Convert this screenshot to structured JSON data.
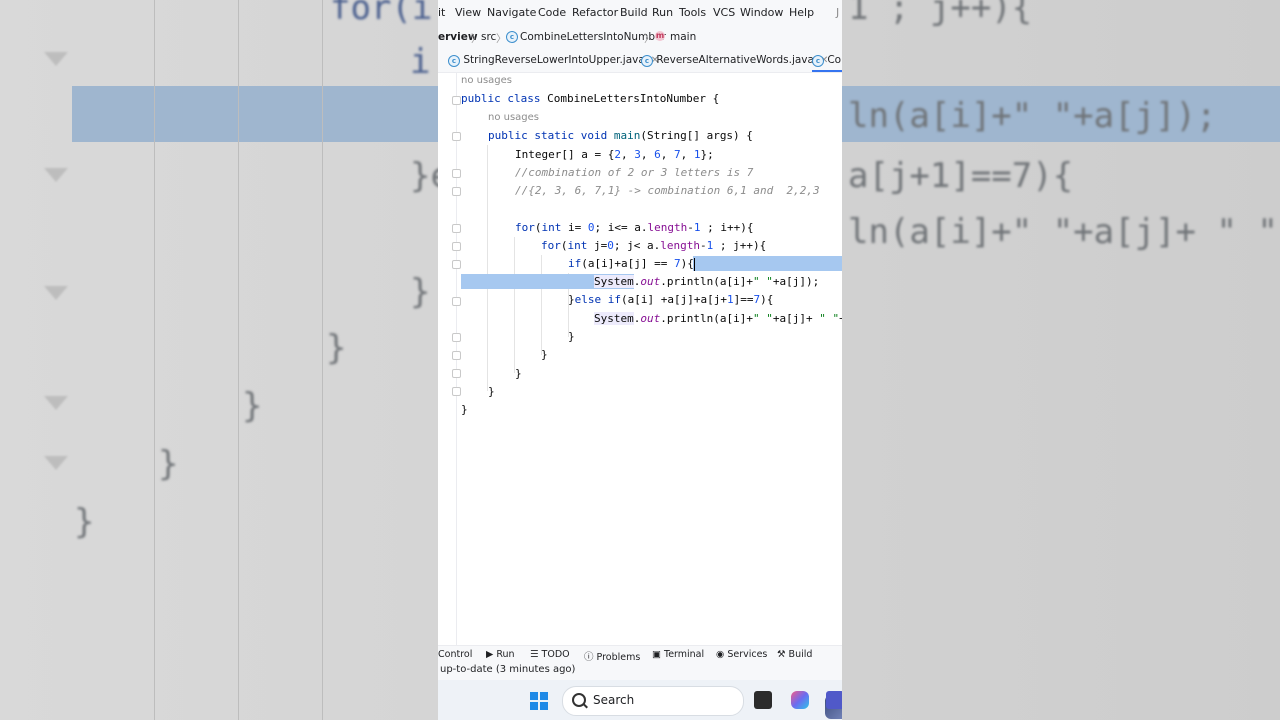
{
  "background_code": {
    "l1": "for(i",
    "l1b": "1 ; j++){",
    "l2": "i",
    "r1": "ln(a[i]+\" \"+a[j]);",
    "r2": "a[j+1]==7){",
    "r3": "ln(a[i]+\" \"+a[j]+ \" \"",
    "b1": "}e",
    "b2": "}",
    "b3": "}",
    "b4": "}",
    "b5": "}",
    "b6": "}"
  },
  "menu": [
    "it",
    "View",
    "Navigate",
    "Code",
    "Refactor",
    "Build",
    "Run",
    "Tools",
    "VCS",
    "Window",
    "Help",
    "J"
  ],
  "breadcrumb": {
    "project": "erview",
    "src": "src",
    "class": "CombineLettersIntoNumber",
    "method": "main",
    "class_icon": "c",
    "method_icon": "m"
  },
  "tabs": [
    {
      "label": "StringReverseLowerIntoUpper.java"
    },
    {
      "label": "ReverseAlternativeWords.java"
    },
    {
      "label": "Co"
    }
  ],
  "editor": {
    "hint1": "no usages",
    "hint2": "no usages",
    "class_decl": {
      "kw": "public class",
      "name": "CombineLettersIntoNumber {"
    },
    "main_decl": {
      "kw": "public static void",
      "name": "main",
      "rest": "(String[] args) {"
    },
    "line_array": {
      "pre": "Integer[] a = {",
      "n1": "2",
      "n2": "3",
      "n3": "6",
      "n4": "7",
      "n5": "1",
      "post": "};"
    },
    "comment1": "//combination of 2 or 3 letters is 7",
    "comment2": "//{2, 3, 6, 7,1} -> combination 6,1 and  2,2,3",
    "for1": {
      "kw": "for",
      "a": "(",
      "kw2": "int",
      "b": " i= ",
      "z": "0",
      "c": "; i<= a.",
      "fld": "length",
      "d": "-",
      "one": "1",
      "e": " ; i++){"
    },
    "for2": {
      "kw": "for",
      "a": "(",
      "kw2": "int",
      "b": " j=",
      "z": "0",
      "c": "; j< a.",
      "fld": "length",
      "d": "-",
      "one": "1",
      "e": " ; j++){"
    },
    "if1": {
      "kw": "if",
      "a": "(a[i]+a[j] == ",
      "n": "7",
      "b": "){"
    },
    "println1": {
      "cls": "System",
      "dot": ".",
      "out": "out",
      "rest1": ".println(a[i]+",
      "s": "\" \"",
      "rest2": "+a[j]);"
    },
    "elseif": {
      "a": "}",
      "kw": "else if",
      "b": "(a[i] +a[j]+a[j+",
      "n1": "1",
      "c": "]==",
      "n2": "7",
      "d": "){"
    },
    "println2": {
      "cls": "System",
      "dot": ".",
      "out": "out",
      "rest1": ".println(a[i]+",
      "s": "\" \"",
      "rest2": "+a[j]+ ",
      "s2": "\" \"",
      "rest3": "+"
    },
    "close1": "}",
    "close2": "}",
    "close3": "}",
    "close4": "}",
    "close5": "}"
  },
  "toolwindows": [
    "Control",
    "Run",
    "TODO",
    "Problems",
    "Terminal",
    "Services",
    "Build"
  ],
  "status": "up-to-date (3 minutes ago)",
  "taskbar": {
    "search": "Search"
  }
}
